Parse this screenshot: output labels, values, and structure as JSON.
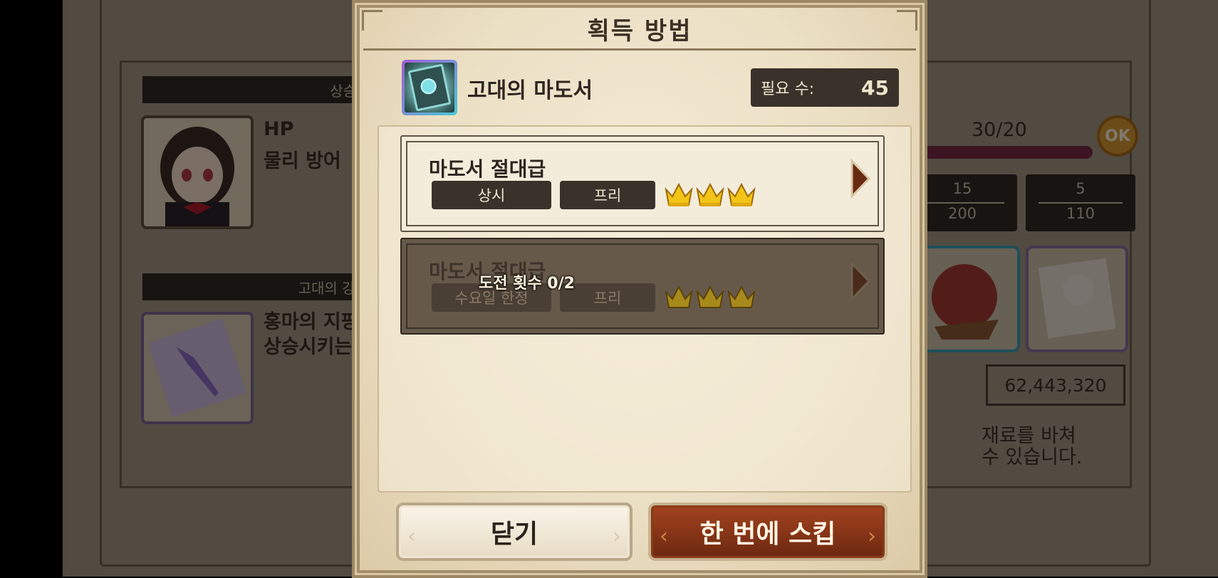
{
  "background": {
    "section1_header": "상승하는 능력",
    "stat_hp": "HP",
    "stat_def": "물리 방어",
    "section2_header": "고대의 강화석(전용",
    "desc_line1": "홍마의 지팡",
    "desc_line2": "상승시키는",
    "progress_text": "30/20",
    "ok_label": "OK",
    "stat_boxes": [
      {
        "top": "15",
        "bottom": "200"
      },
      {
        "top": "5",
        "bottom": "110"
      }
    ],
    "gold_amount": "62,443,320",
    "notice_line1": "재료를 바쳐",
    "notice_line2": "수 있습니다."
  },
  "modal": {
    "title": "획득 방법",
    "item_name": "고대의 마도서",
    "required_label": "필요 수:",
    "required_value": "45",
    "sources": [
      {
        "title": "마도서 절대급",
        "tag1": "상시",
        "tag2": "프리",
        "crowns": 3,
        "locked": false
      },
      {
        "title": "마도서 절대급",
        "tag1": "수요일 한정",
        "tag2": "프리",
        "crowns": 3,
        "locked": true,
        "lock_text": "도전 횟수 0/2"
      }
    ],
    "close_button": "닫기",
    "skip_button": "한 번에 스킵"
  },
  "icons": [
    "ancient-grimoire-icon",
    "crown-icon",
    "arrow-right-icon",
    "ok-icon"
  ],
  "colors": {
    "title_text": "#3b3025",
    "dark_tag": "#3a322a",
    "skip_button": "#7a2e12",
    "crown": "#f2c417"
  }
}
